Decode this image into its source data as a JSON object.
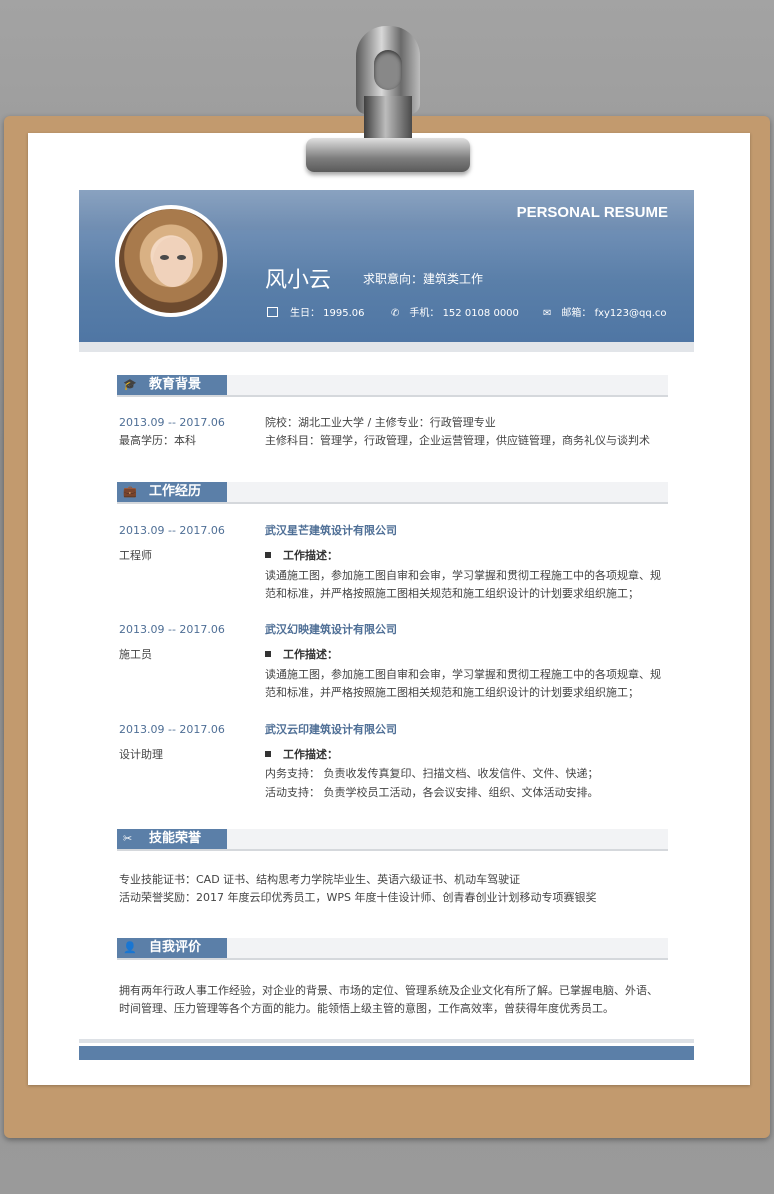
{
  "header": {
    "tag": "PERSONAL RESUME",
    "name": "风小云",
    "intent": "求职意向：建筑类工作",
    "birthday": "生日： 1995.06",
    "phone": "手机： 152 0108 0000",
    "email": "邮箱： fxy123@qq.co"
  },
  "education": {
    "title": "教育背景",
    "date": "2013.09 -- 2017.06",
    "degree": "最高学历：本科",
    "school": "院校：湖北工业大学     /     主修专业：行政管理专业",
    "courses": "主修科目：管理学，行政管理，企业运营管理，供应链管理，商务礼仪与谈判术"
  },
  "work": {
    "title": "工作经历",
    "jobs": [
      {
        "date": "2013.09 -- 2017.06",
        "role": "工程师",
        "company": "武汉星芒建筑设计有限公司",
        "desc_label": "工作描述：",
        "line1": "读通施工图，参加施工图自审和会审，学习掌握和贯彻工程施工中的各项规章、规",
        "line2": "范和标准，并严格按照施工图相关规范和施工组织设计的计划要求组织施工；"
      },
      {
        "date": "2013.09 -- 2017.06",
        "role": "施工员",
        "company": "武汉幻映建筑设计有限公司",
        "desc_label": "工作描述：",
        "line1": "读通施工图，参加施工图自审和会审，学习掌握和贯彻工程施工中的各项规章、规",
        "line2": "范和标准，并严格按照施工图相关规范和施工组织设计的计划要求组织施工；"
      },
      {
        "date": "2013.09 -- 2017.06",
        "role": "设计助理",
        "company": "武汉云印建筑设计有限公司",
        "desc_label": "工作描述：",
        "line1": "内务支持：    负责收发传真复印、扫描文档、收发信件、文件、快递；",
        "line2": "活动支持：    负责学校员工活动，各会议安排、组织、文体活动安排。"
      }
    ]
  },
  "skills": {
    "title": "技能荣誉",
    "line1": "专业技能证书：CAD 证书、结构思考力学院毕业生、英语六级证书、机动车驾驶证",
    "line2": "活动荣誉奖励：2017 年度云印优秀员工，WPS 年度十佳设计师、创青春创业计划移动专项赛银奖"
  },
  "self": {
    "title": "自我评价",
    "line1": "拥有两年行政人事工作经验，对企业的背景、市场的定位、管理系统及企业文化有所了解。已掌握电脑、外语、",
    "line2": "时间管理、压力管理等各个方面的能力。能领悟上级主管的意图，工作高效率，曾获得年度优秀员工。"
  }
}
